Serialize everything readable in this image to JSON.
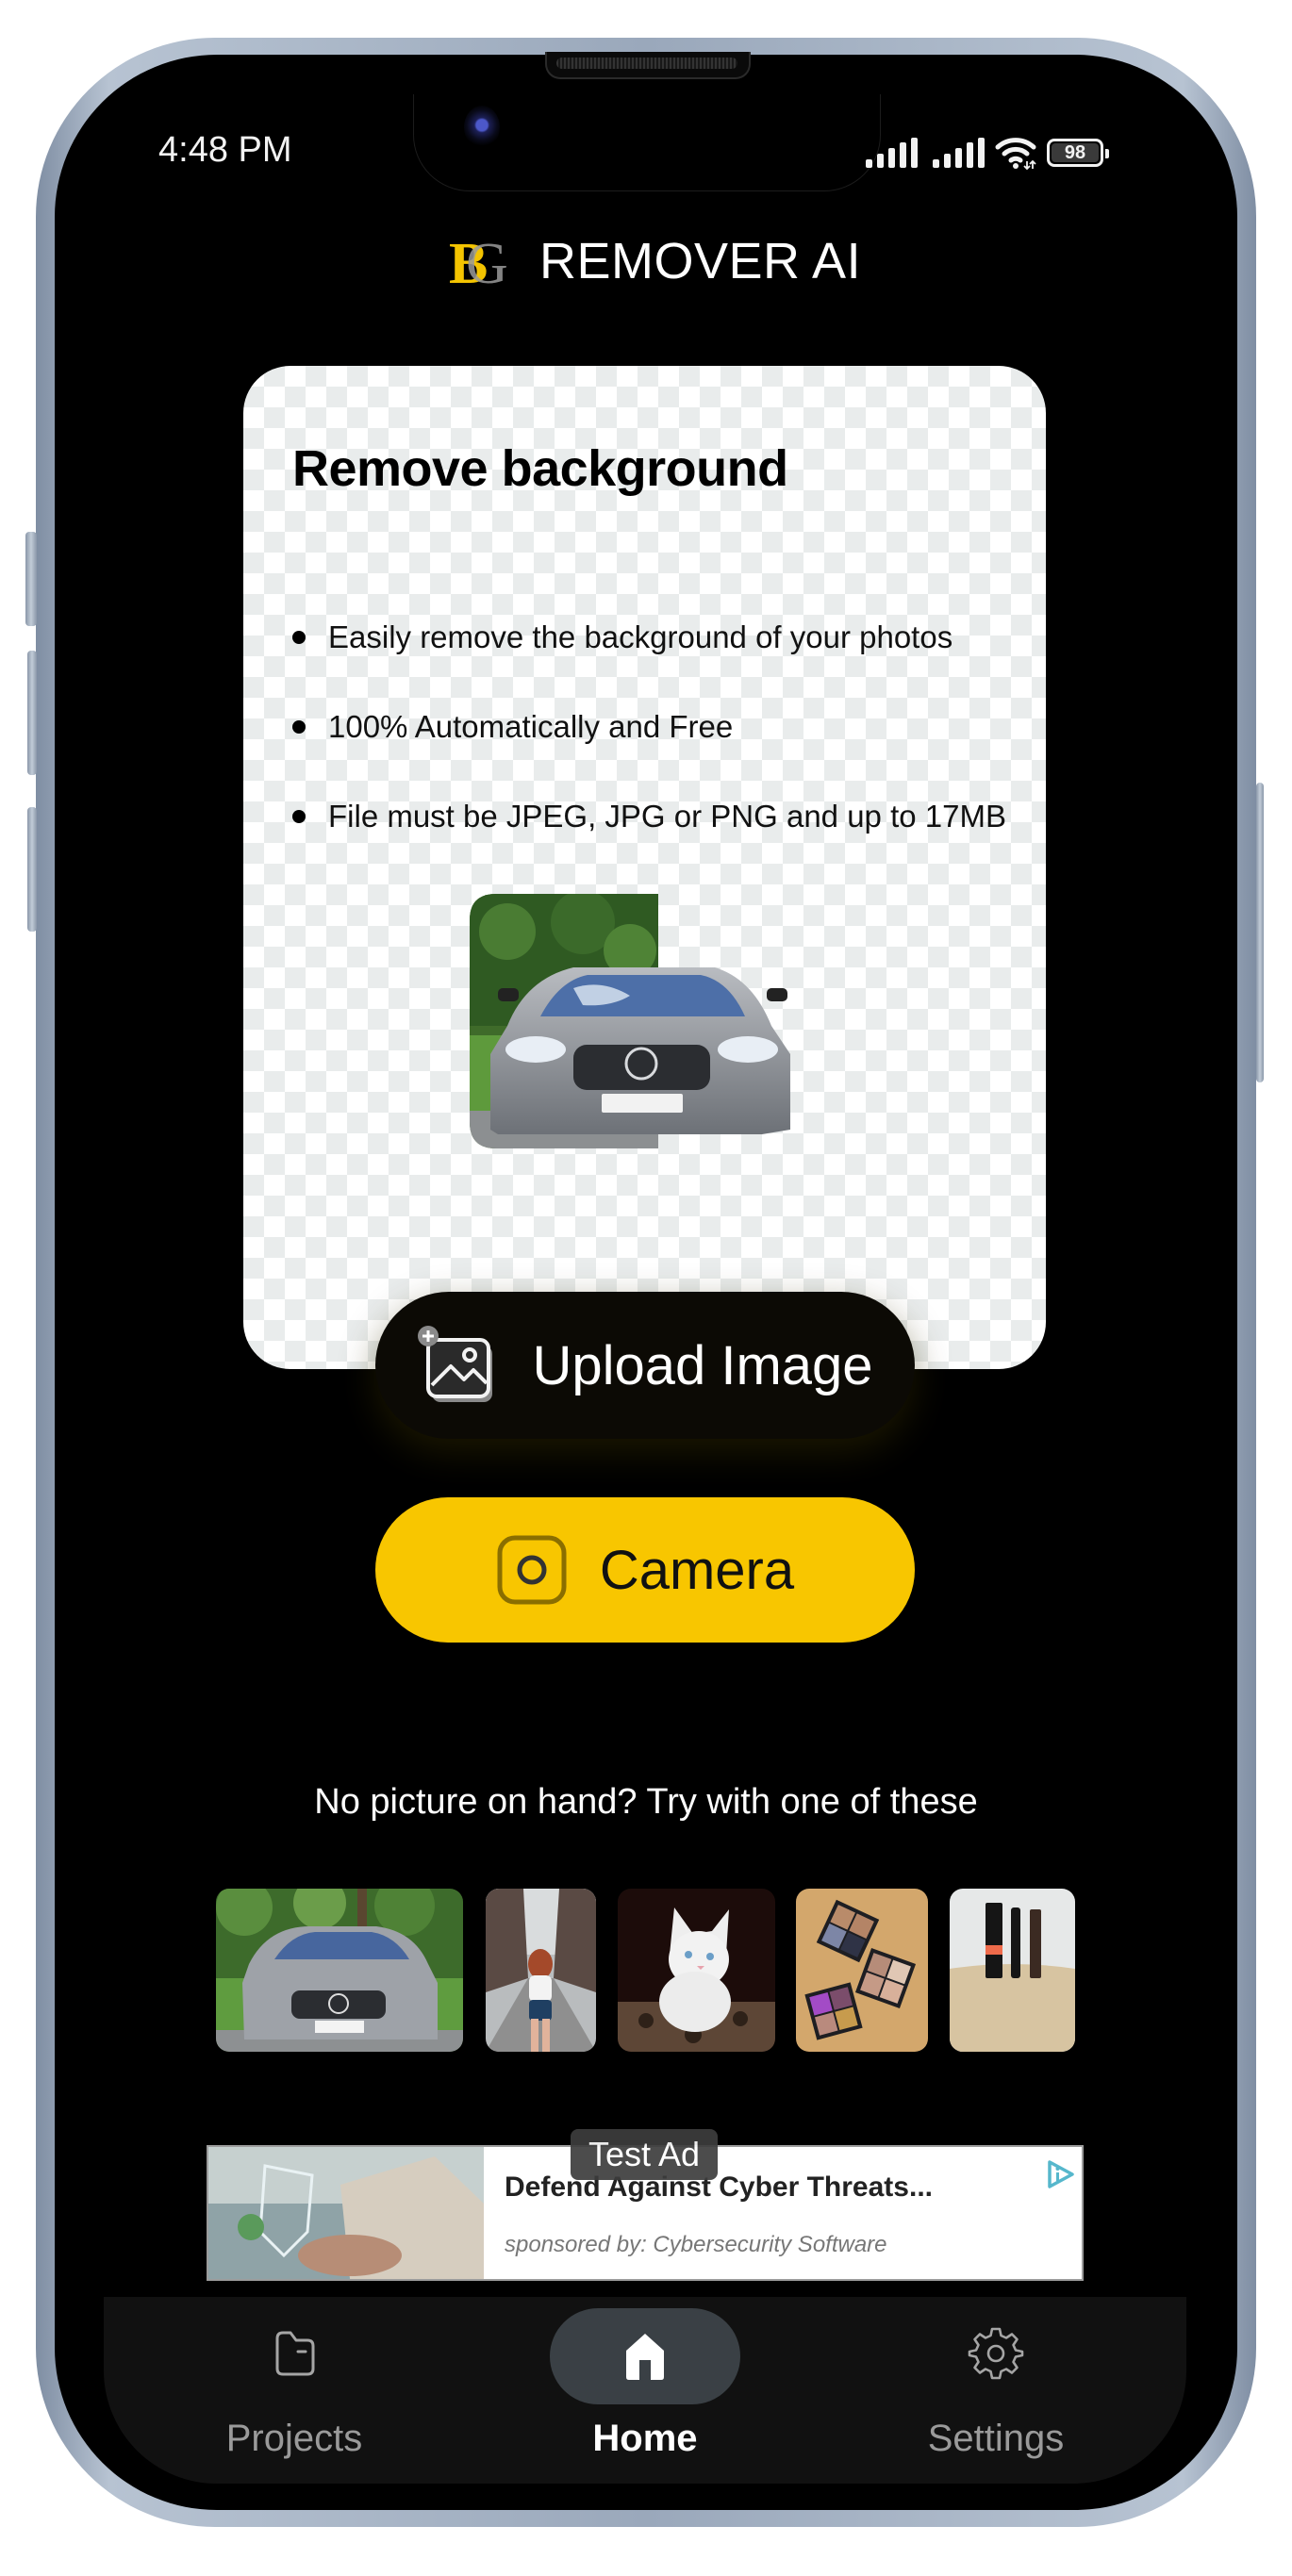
{
  "status_bar": {
    "time": "4:48 PM",
    "battery_level": "98",
    "icons": [
      "signal-icon",
      "signal-icon",
      "wifi-icon",
      "battery-icon"
    ]
  },
  "header": {
    "logo_text": "BG",
    "title": "REMOVER AI"
  },
  "card": {
    "title": "Remove background",
    "bullets": [
      "Easily remove the background of your photos",
      "100% Automatically and Free",
      "File must be JPEG, JPG or PNG and up to 17MB"
    ],
    "preview_alt": "car-before-after-preview"
  },
  "actions": {
    "upload_label": "Upload Image",
    "camera_label": "Camera",
    "accent_color": "#f8c600"
  },
  "samples": {
    "prompt": "No picture on hand? Try with one of these",
    "items": [
      {
        "name": "sample-car"
      },
      {
        "name": "sample-woman-on-road"
      },
      {
        "name": "sample-kitten"
      },
      {
        "name": "sample-eyeshadow-palettes"
      },
      {
        "name": "sample-makeup-products"
      }
    ]
  },
  "ad": {
    "badge": "Test Ad",
    "title": "Defend Against Cyber Threats...",
    "sponsor": "sponsored by: Cybersecurity Software"
  },
  "nav": {
    "items": [
      {
        "label": "Projects",
        "icon": "folder-icon",
        "active": false
      },
      {
        "label": "Home",
        "icon": "home-icon",
        "active": true
      },
      {
        "label": "Settings",
        "icon": "gear-icon",
        "active": false
      }
    ]
  }
}
